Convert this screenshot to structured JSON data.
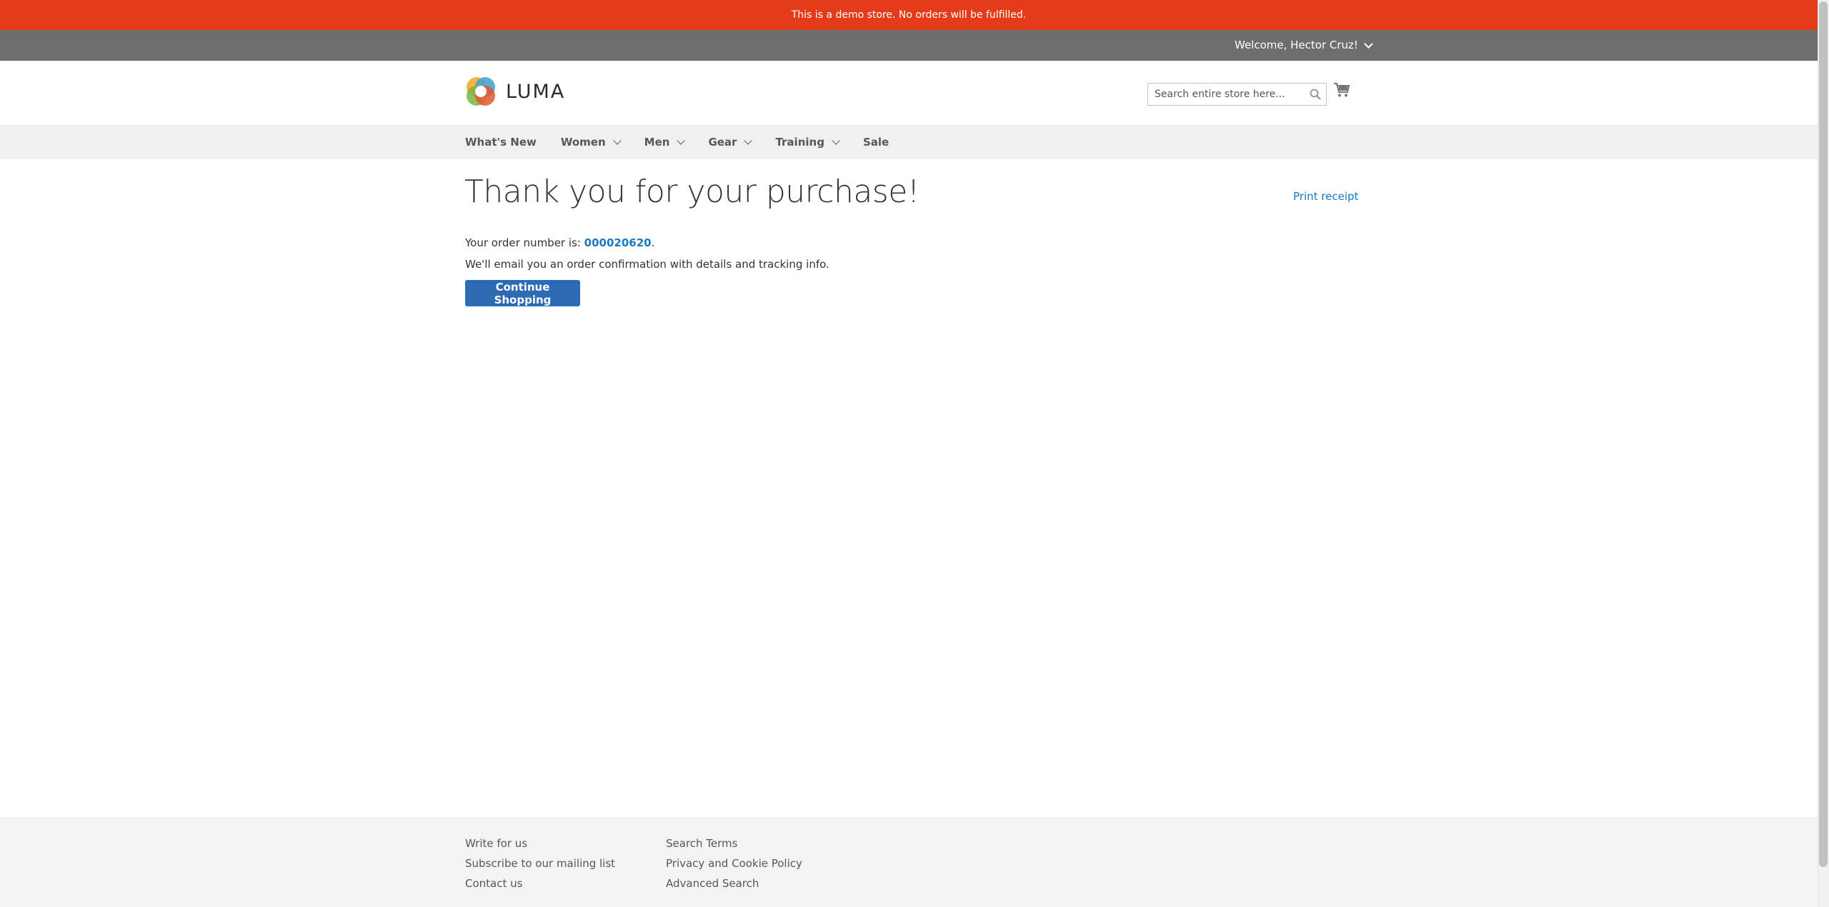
{
  "notice": {
    "text": "This is a demo store. No orders will be fulfilled."
  },
  "header": {
    "welcome": "Welcome, Hector Cruz!",
    "logo_text": "LUMA",
    "search_placeholder": "Search entire store here..."
  },
  "nav": {
    "items": [
      {
        "label": "What's New",
        "has_dropdown": false
      },
      {
        "label": "Women",
        "has_dropdown": true
      },
      {
        "label": "Men",
        "has_dropdown": true
      },
      {
        "label": "Gear",
        "has_dropdown": true
      },
      {
        "label": "Training",
        "has_dropdown": true
      },
      {
        "label": "Sale",
        "has_dropdown": false
      }
    ]
  },
  "main": {
    "title": "Thank you for your purchase!",
    "print_receipt": "Print receipt",
    "order_prefix": "Your order number is: ",
    "order_number": "000020620",
    "order_suffix": ".",
    "email_note": "We'll email you an order confirmation with details and tracking info.",
    "continue_button": "Continue Shopping"
  },
  "footer": {
    "col1": [
      "Write for us",
      "Subscribe to our mailing list",
      "Contact us"
    ],
    "col2": [
      "Search Terms",
      "Privacy and Cookie Policy",
      "Advanced Search"
    ]
  },
  "colors": {
    "notice_bg": "#e43c1a",
    "header_bar_bg": "#6e6e6e",
    "link": "#1979c3",
    "button_bg": "#2e6ab3"
  }
}
